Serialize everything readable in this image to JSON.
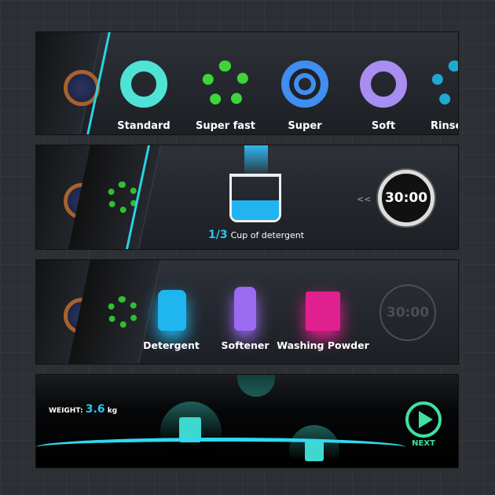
{
  "modes": [
    {
      "label": "Standard",
      "color": "#4fe3d6"
    },
    {
      "label": "Super fast",
      "color": "#3fd43a"
    },
    {
      "label": "Super",
      "color": "#3f8ef0"
    },
    {
      "label": "Soft",
      "color": "#a78ef0"
    },
    {
      "label": "Rinse+D",
      "color": "#1fa8d0"
    }
  ],
  "dose": {
    "amount": "1/3",
    "text": "Cup of detergent",
    "rewind": "<<",
    "timer": "30:00",
    "fill_fraction": 0.33
  },
  "detergents": [
    {
      "label": "Detergent",
      "color": "#1fb6f0"
    },
    {
      "label": "Softener",
      "color": "#9b6af0"
    },
    {
      "label": "Washing Powder",
      "color": "#e0208f"
    }
  ],
  "timer_inactive": "30:00",
  "weight": {
    "label": "WEIGHT:",
    "value": "3.6",
    "unit": "kg"
  },
  "next": {
    "label": "NEXT",
    "color": "#3fe0a0"
  }
}
